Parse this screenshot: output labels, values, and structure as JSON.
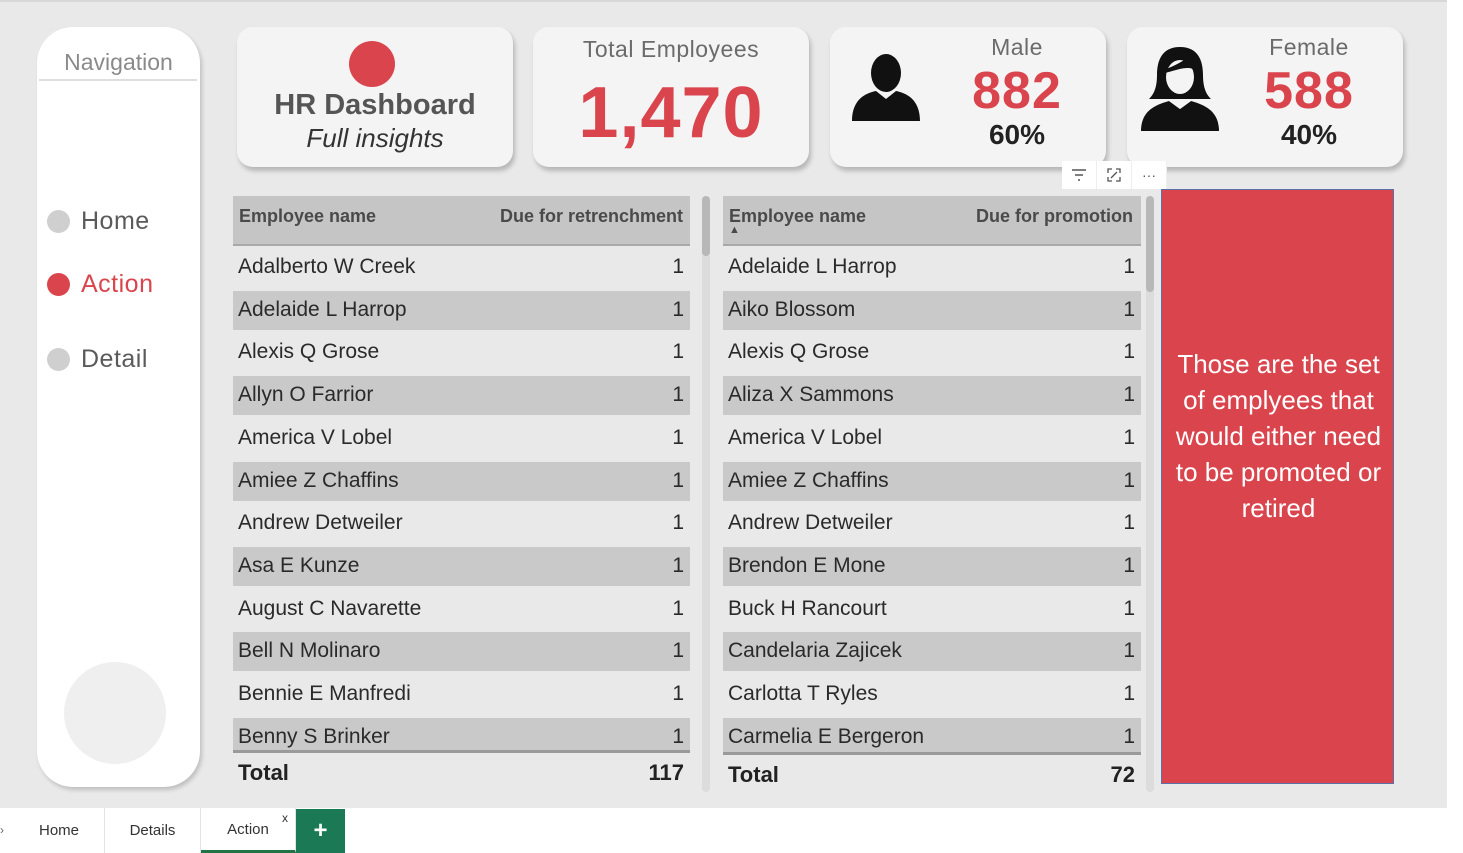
{
  "navigation": {
    "title": "Navigation",
    "items": [
      {
        "label": "Home",
        "active": false
      },
      {
        "label": "Action",
        "active": true
      },
      {
        "label": "Detail",
        "active": false
      }
    ]
  },
  "cards": {
    "hr": {
      "title": "HR Dashboard",
      "subtitle": "Full insights"
    },
    "total": {
      "label": "Total Employees",
      "value": "1,470"
    },
    "male": {
      "label": "Male",
      "value": "882",
      "pct": "60%",
      "icon": "male-person-icon"
    },
    "female": {
      "label": "Female",
      "value": "588",
      "pct": "40%",
      "icon": "female-person-icon"
    }
  },
  "retrenchment_table": {
    "col_name": "Employee name",
    "col_value": "Due for retrenchment",
    "rows": [
      {
        "name": "Adalberto W Creek",
        "value": "1"
      },
      {
        "name": "Adelaide L Harrop",
        "value": "1"
      },
      {
        "name": "Alexis Q Grose",
        "value": "1"
      },
      {
        "name": "Allyn O Farrior",
        "value": "1"
      },
      {
        "name": "America V Lobel",
        "value": "1"
      },
      {
        "name": "Amiee Z Chaffins",
        "value": "1"
      },
      {
        "name": "Andrew Detweiler",
        "value": "1"
      },
      {
        "name": "Asa E Kunze",
        "value": "1"
      },
      {
        "name": "August C Navarette",
        "value": "1"
      },
      {
        "name": "Bell N Molinaro",
        "value": "1"
      },
      {
        "name": "Bennie E Manfredi",
        "value": "1"
      },
      {
        "name": "Benny S Brinker",
        "value": "1"
      }
    ],
    "total_label": "Total",
    "total_value": "117"
  },
  "promotion_table": {
    "col_name": "Employee name",
    "col_value": "Due for promotion",
    "sort_indicator": "▲",
    "rows": [
      {
        "name": "Adelaide L Harrop",
        "value": "1"
      },
      {
        "name": "Aiko Blossom",
        "value": "1"
      },
      {
        "name": "Alexis Q Grose",
        "value": "1"
      },
      {
        "name": "Aliza X Sammons",
        "value": "1"
      },
      {
        "name": "America V Lobel",
        "value": "1"
      },
      {
        "name": "Amiee Z Chaffins",
        "value": "1"
      },
      {
        "name": "Andrew Detweiler",
        "value": "1"
      },
      {
        "name": "Brendon E Mone",
        "value": "1"
      },
      {
        "name": "Buck H Rancourt",
        "value": "1"
      },
      {
        "name": "Candelaria Zajicek",
        "value": "1"
      },
      {
        "name": "Carlotta T Ryles",
        "value": "1"
      },
      {
        "name": "Carmelia E Bergeron",
        "value": "1"
      }
    ],
    "total_label": "Total",
    "total_value": "72"
  },
  "note": {
    "text": "Those are the set of emplyees that would either need to be promoted or retired"
  },
  "visual_toolbar": {
    "icons": [
      "filter-icon",
      "focus-mode-icon",
      "more-options-icon"
    ],
    "more": "···"
  },
  "tabs": {
    "items": [
      {
        "label": "Home",
        "active": false
      },
      {
        "label": "Details",
        "active": false
      },
      {
        "label": "Action",
        "active": true
      }
    ],
    "close": "x",
    "add": "+"
  },
  "colors": {
    "accent": "#d9444d",
    "tab_add": "#1b7a55"
  }
}
